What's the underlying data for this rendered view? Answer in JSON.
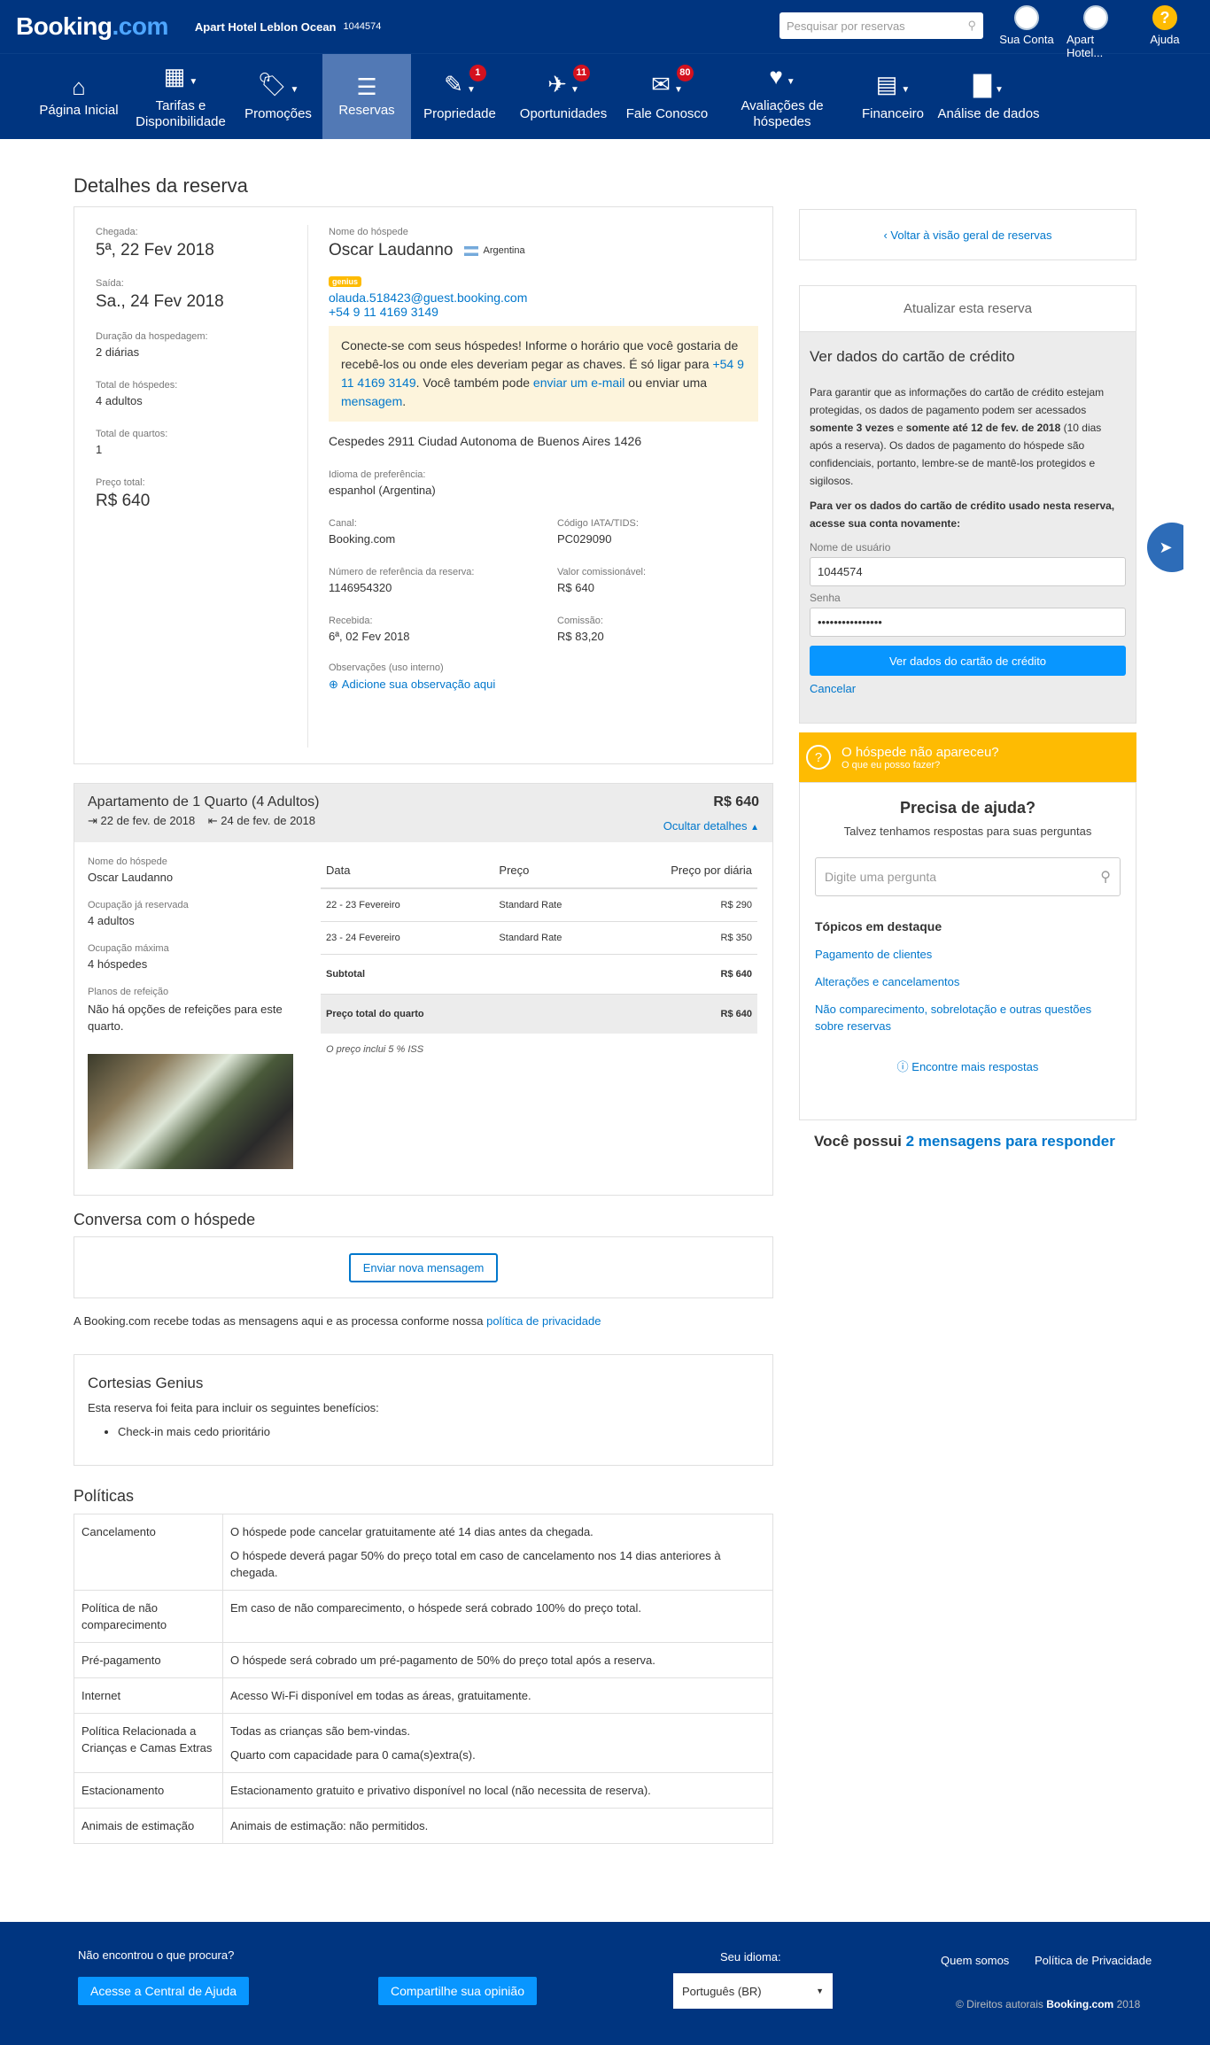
{
  "header": {
    "logo": "Booking",
    "logo_suffix": ".com",
    "hotel_name": "Apart Hotel Leblon Ocean",
    "hotel_id": "1044574",
    "search_placeholder": "Pesquisar por reservas",
    "account_label": "Sua Conta",
    "hotel_label": "Apart Hotel...",
    "help_label": "Ajuda"
  },
  "nav": [
    {
      "label": "Página Inicial",
      "icon": "home-icon",
      "glyph": "⌂",
      "badge": "",
      "caret": false
    },
    {
      "label": "Tarifas e Disponibilidade",
      "icon": "calendar-icon",
      "glyph": "▦",
      "badge": "",
      "caret": true
    },
    {
      "label": "Promoções",
      "icon": "tag-icon",
      "glyph": "🏷",
      "badge": "",
      "caret": true
    },
    {
      "label": "Reservas",
      "icon": "list-icon",
      "glyph": "☰",
      "badge": "",
      "caret": false,
      "active": true
    },
    {
      "label": "Propriedade",
      "icon": "pencil-icon",
      "glyph": "✎",
      "badge": "1",
      "caret": true
    },
    {
      "label": "Oportunidades",
      "icon": "rocket-icon",
      "glyph": "✈",
      "badge": "11",
      "caret": true
    },
    {
      "label": "Fale Conosco",
      "icon": "mail-icon",
      "glyph": "✉",
      "badge": "80",
      "caret": true
    },
    {
      "label": "Avaliações de hóspedes",
      "icon": "heart-icon",
      "glyph": "♥",
      "badge": "",
      "caret": true
    },
    {
      "label": "Financeiro",
      "icon": "ledger-icon",
      "glyph": "▤",
      "badge": "",
      "caret": true
    },
    {
      "label": "Análise de dados",
      "icon": "bar-chart-icon",
      "glyph": "▇",
      "badge": "",
      "caret": true
    }
  ],
  "page_title": "Detalhes da reserva",
  "booking": {
    "arrival_label": "Chegada:",
    "arrival": "5ª, 22 Fev 2018",
    "departure_label": "Saída:",
    "departure": "Sa., 24 Fev 2018",
    "duration_label": "Duração da hospedagem:",
    "duration": "2 diárias",
    "guests_label": "Total de hóspedes:",
    "guests": "4 adultos",
    "rooms_label": "Total de quartos:",
    "rooms": "1",
    "price_label": "Preço total:",
    "price": "R$ 640",
    "guest_name_label": "Nome do hóspede",
    "guest_name": "Oscar Laudanno",
    "country": "Argentina",
    "genius": "genius",
    "email": "olauda.518423@guest.booking.com",
    "phone": "+54 9 11 4169 3149",
    "connect_text_1": "Conecte-se com seus hóspedes! Informe o horário que você gostaria de recebê-los ou onde eles deveriam pegar as chaves. É só ligar para ",
    "connect_phone": "+54 9 11 4169 3149",
    "connect_text_2": ". Você também pode ",
    "connect_email": "enviar um e-mail",
    "connect_text_3": " ou enviar uma ",
    "connect_msg": "mensagem",
    "connect_text_4": ".",
    "address": "Cespedes 2911 Ciudad Autonoma de Buenos Aires 1426",
    "lang_label": "Idioma de preferência:",
    "lang": "espanhol (Argentina)",
    "channel_label": "Canal:",
    "channel": "Booking.com",
    "iata_label": "Código IATA/TIDS:",
    "iata": "PC029090",
    "ref_label": "Número de referência da reserva:",
    "ref": "1146954320",
    "commissionable_label": "Valor comissionável:",
    "commissionable": "R$ 640",
    "received_label": "Recebida:",
    "received": "6ª, 02 Fev 2018",
    "commission_label": "Comissão:",
    "commission": "R$ 83,20",
    "notes_label": "Observações (uso interno)",
    "notes_link": "Adicione sua observação aqui"
  },
  "room": {
    "title": "Apartamento de 1 Quarto (4 Adultos)",
    "price": "R$ 640",
    "checkin": "22 de fev. de 2018",
    "checkout": "24 de fev. de 2018",
    "hide_details": "Ocultar detalhes",
    "guest_label": "Nome do hóspede",
    "guest": "Oscar Laudanno",
    "occupancy_label": "Ocupação já reservada",
    "occupancy": "4 adultos",
    "max_label": "Ocupação máxima",
    "max": "4 hóspedes",
    "meal_label": "Planos de refeição",
    "meal": "Não há opções de refeições para este quarto.",
    "table_headers": [
      "Data",
      "Preço",
      "Preço por diária"
    ],
    "rows": [
      [
        "22 - 23 Fevereiro",
        "Standard Rate",
        "R$ 290"
      ],
      [
        "23 - 24 Fevereiro",
        "Standard Rate",
        "R$ 350"
      ]
    ],
    "subtotal_label": "Subtotal",
    "subtotal": "R$ 640",
    "total_label": "Preço total do quarto",
    "total": "R$ 640",
    "tax_note": "O preço inclui 5 % ISS"
  },
  "conversation": {
    "title": "Conversa com o hóspede",
    "button": "Enviar nova mensagem",
    "notice": "A Booking.com recebe todas as mensagens aqui e as processa conforme nossa ",
    "notice_link": "política de privacidade"
  },
  "genius_perks": {
    "title": "Cortesias Genius",
    "intro": "Esta reserva foi feita para incluir os seguintes benefícios:",
    "items": [
      "Check-in mais cedo prioritário"
    ]
  },
  "policies": {
    "title": "Políticas",
    "rows": [
      {
        "name": "Cancelamento",
        "texts": [
          "O hóspede pode cancelar gratuitamente até 14 dias antes da chegada.",
          "O hóspede deverá pagar 50% do preço total em caso de cancelamento nos 14 dias anteriores à chegada."
        ]
      },
      {
        "name": "Política de não comparecimento",
        "texts": [
          "Em caso de não comparecimento, o hóspede será cobrado 100% do preço total."
        ]
      },
      {
        "name": "Pré-pagamento",
        "texts": [
          "O hóspede será cobrado um pré-pagamento de 50% do preço total após a reserva."
        ]
      },
      {
        "name": "Internet",
        "texts": [
          "Acesso Wi-Fi disponível em todas as áreas, gratuitamente."
        ]
      },
      {
        "name": "Política Relacionada a Crianças e Camas Extras",
        "texts": [
          "Todas as crianças são bem-vindas.",
          "Quarto com capacidade para 0 cama(s)extra(s)."
        ]
      },
      {
        "name": "Estacionamento",
        "texts": [
          "Estacionamento gratuito e privativo disponível no local (não necessita de reserva)."
        ]
      },
      {
        "name": "Animais de estimação",
        "texts": [
          "Animais de estimação: não permitidos."
        ]
      }
    ]
  },
  "sidebar": {
    "back_link": "Voltar à visão geral de reservas",
    "update_title": "Atualizar esta reserva",
    "cc_title": "Ver dados do cartão de crédito",
    "cc_text_1": "Para garantir que as informações do cartão de crédito estejam protegidas, os dados de pagamento podem ser acessados ",
    "cc_bold_1": "somente 3 vezes",
    "cc_text_2": " e ",
    "cc_bold_2": "somente até 12 de fev. de 2018",
    "cc_text_3": " (10 dias após a reserva). Os dados de pagamento do hóspede são confidenciais, portanto, lembre-se de mantê-los protegidos e sigilosos.",
    "cc_login_prompt": "Para ver os dados do cartão de crédito usado nesta reserva, acesse sua conta novamente:",
    "username_label": "Nome de usuário",
    "username": "1044574",
    "password_label": "Senha",
    "password": "••••••••••••••••",
    "cc_button": "Ver dados do cartão de crédito",
    "cancel": "Cancelar",
    "noshow_title": "O hóspede não apareceu?",
    "noshow_sub": "O que eu posso fazer?",
    "help_title": "Precisa de ajuda?",
    "help_sub": "Talvez tenhamos respostas para suas perguntas",
    "help_placeholder": "Digite uma pergunta",
    "topics_title": "Tópicos em destaque",
    "topics": [
      "Pagamento de clientes",
      "Alterações e cancelamentos",
      "Não comparecimento, sobrelotação e outras questões sobre reservas"
    ],
    "more_answers": "Encontre mais respostas",
    "messages_prefix": "Você possui ",
    "messages_link": "2 mensagens para responder"
  },
  "footer": {
    "question": "Não encontrou o que procura?",
    "help_button": "Acesse a Central de Ajuda",
    "feedback_button": "Compartilhe sua opinião",
    "lang_label": "Seu idioma:",
    "lang_value": "Português (BR)",
    "about": "Quem somos",
    "privacy": "Política de Privacidade",
    "copyright_prefix": "© Direitos autorais ",
    "copyright_brand": "Booking.com",
    "copyright_year": " 2018"
  }
}
